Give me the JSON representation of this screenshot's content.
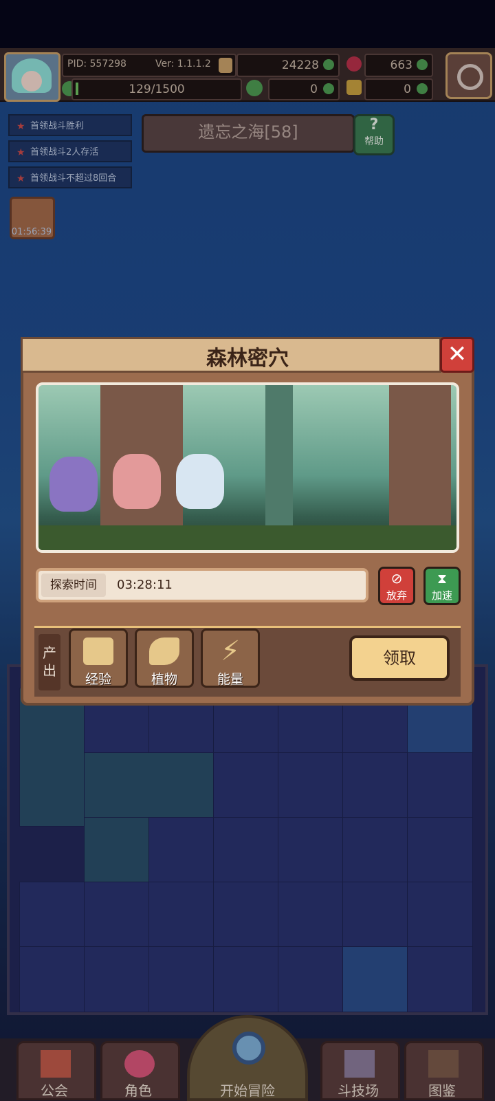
{
  "hud": {
    "pid": "PID: 557298",
    "version": "Ver: 1.1.1.2",
    "gold": "24228",
    "gems": "663",
    "exp": "129/1500",
    "clover": "0",
    "keys": "0"
  },
  "quests": [
    {
      "label": "首领战斗胜利"
    },
    {
      "label": "首领战斗2人存活"
    },
    {
      "label": "首领战斗不超过8回合"
    }
  ],
  "map": {
    "name": "遗忘之海[58]",
    "help_label": "帮助"
  },
  "gift": {
    "timer": "01:56:39"
  },
  "dialog": {
    "title": "森林密穴",
    "close_label": "✕",
    "time_label": "探索时间",
    "time_value": "03:28:11",
    "abandon_label": "放弃",
    "speedup_label": "加速",
    "output_label": "产出",
    "rewards": [
      {
        "label": "经验",
        "icon": "exp-chevron-icon"
      },
      {
        "label": "植物",
        "icon": "leaf-icon"
      },
      {
        "label": "能量",
        "icon": "lightning-icon"
      }
    ],
    "claim_label": "领取"
  },
  "nav": [
    {
      "label": "公会",
      "icon": "guild-icon"
    },
    {
      "label": "角色",
      "icon": "character-icon"
    },
    {
      "label": "开始冒险",
      "icon": "magnifier-icon"
    },
    {
      "label": "斗技场",
      "icon": "swords-icon"
    },
    {
      "label": "图鉴",
      "icon": "book-icon"
    }
  ]
}
